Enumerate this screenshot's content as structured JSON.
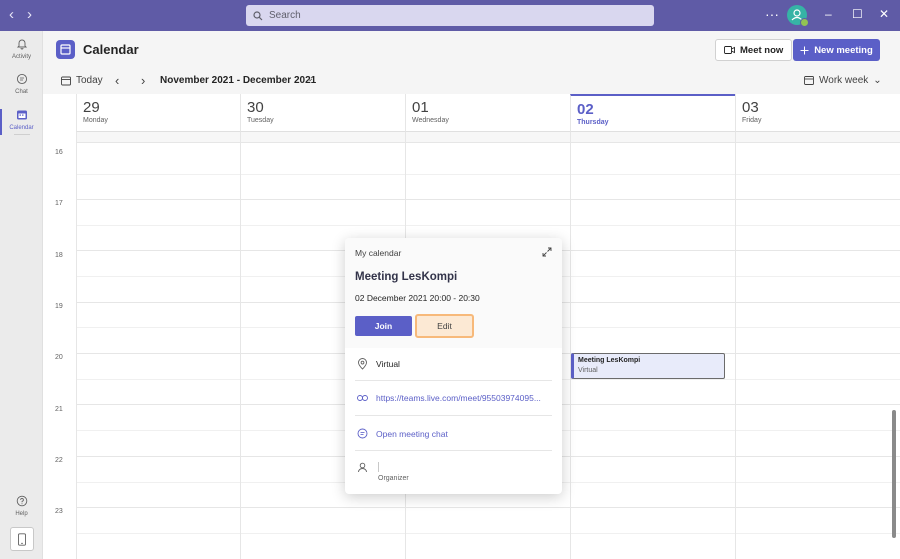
{
  "titlebar": {
    "back_icon": "chevron-left-icon",
    "forward_icon": "chevron-right-icon",
    "search_placeholder": "Search",
    "more_label": "···",
    "avatar_color": "#36b3a6",
    "status_color": "#92c353",
    "minimize": "–",
    "maximize": "☐",
    "close": "✕"
  },
  "rail": {
    "items": [
      {
        "label": "Activity",
        "icon": "bell-icon"
      },
      {
        "label": "Chat",
        "icon": "chat-icon"
      },
      {
        "label": "Calendar",
        "icon": "calendar-icon"
      },
      {
        "label": "Help",
        "icon": "help-icon"
      }
    ],
    "active_color": "#5b5fc7"
  },
  "header": {
    "title": "Calendar",
    "meet_now": "Meet now",
    "new_meeting": "New meeting"
  },
  "toolbar": {
    "today": "Today",
    "prev": "‹",
    "next": "›",
    "range": "November 2021 - December 2021",
    "range_chevron": "⌄",
    "view": "Work week",
    "view_chevron": "⌄"
  },
  "days": [
    {
      "num": "29",
      "name": "Monday"
    },
    {
      "num": "30",
      "name": "Tuesday"
    },
    {
      "num": "01",
      "name": "Wednesday"
    },
    {
      "num": "02",
      "name": "Thursday"
    },
    {
      "num": "03",
      "name": "Friday"
    }
  ],
  "hours": [
    "16",
    "17",
    "18",
    "19",
    "20",
    "21",
    "22",
    "23"
  ],
  "event": {
    "title": "Meeting LesKompi",
    "location": "Virtual"
  },
  "popup": {
    "calendar_name": "My calendar",
    "title": "Meeting LesKompi",
    "time": "02 December 2021 20:00 - 20:30",
    "join": "Join",
    "edit": "Edit",
    "location": "Virtual",
    "link": "https://teams.live.com/meet/95503974095...",
    "chat": "Open meeting chat",
    "organizer_label": "Organizer"
  },
  "colors": {
    "brand": "#5b5fc7",
    "titlebar": "#5f5ba6",
    "edit_highlight": "#f7b97a"
  }
}
